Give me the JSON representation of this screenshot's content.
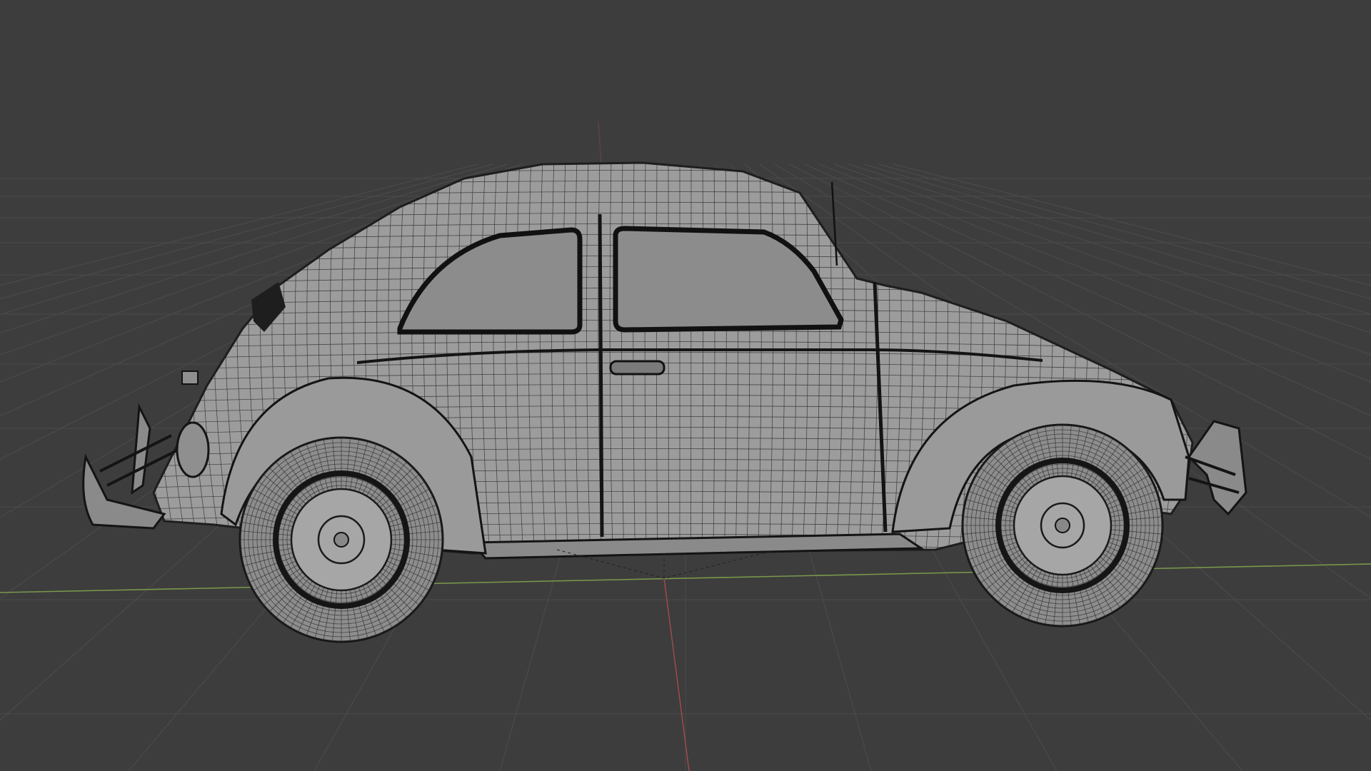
{
  "viewport": {
    "mode": "wireframe",
    "background_color": "#3d3d3d",
    "grid_color": "#4a4a4a",
    "axis_x_color": "#7a9a4a",
    "axis_y_color": "#a04a4a"
  },
  "object": {
    "type": "car-mesh",
    "shading": "wireframe-overlay",
    "mesh_color": "#9c9c9c",
    "edge_color": "#2b2b2b"
  }
}
